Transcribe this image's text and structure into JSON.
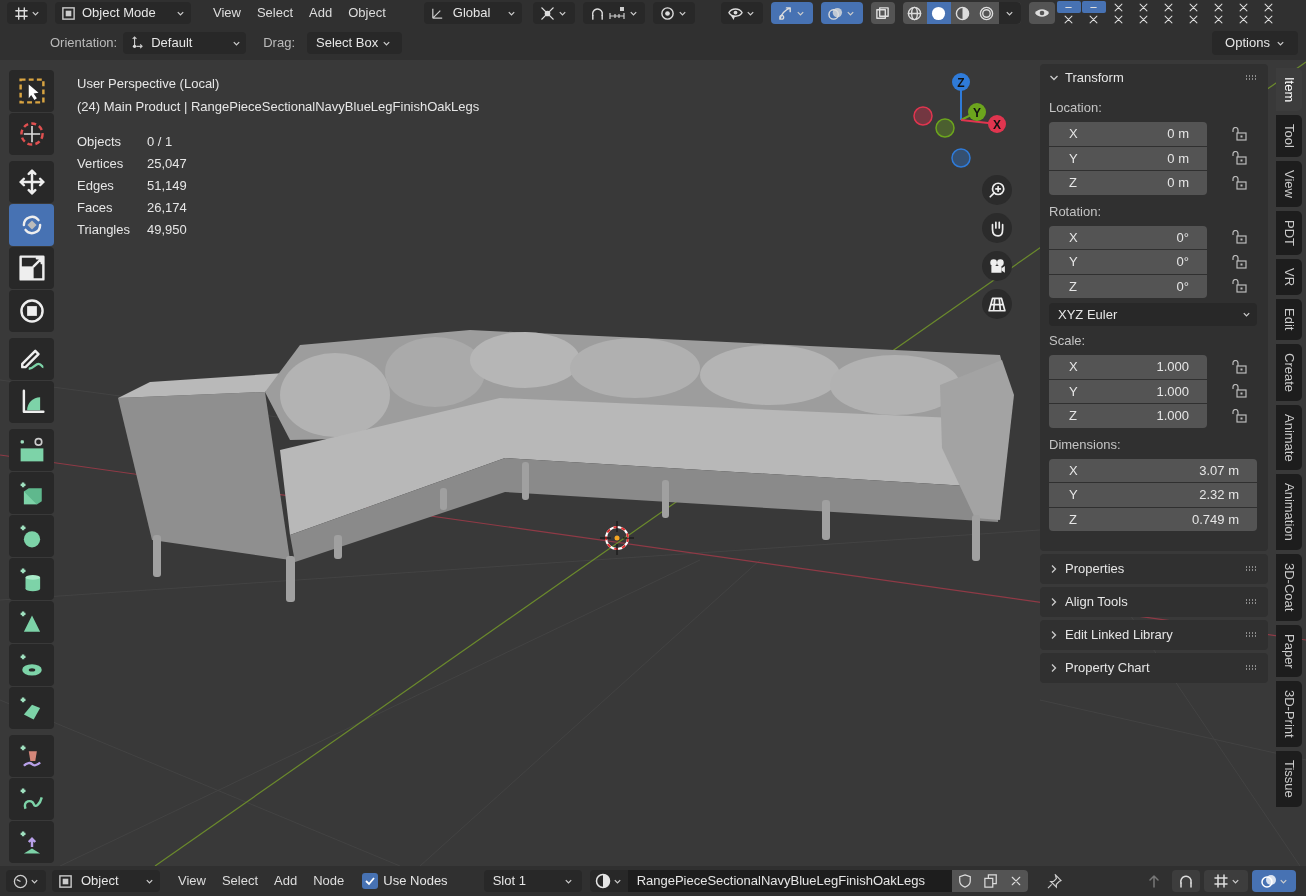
{
  "header": {
    "mode": "Object Mode",
    "menus": [
      "View",
      "Select",
      "Add",
      "Object"
    ],
    "orientation": "Global",
    "toggles": [
      {
        "kind": "pivot",
        "selected": false
      },
      {
        "kind": "snap",
        "selected": false
      },
      {
        "kind": "proportional",
        "selected": false
      },
      {
        "kind": "selectability",
        "selected": false
      },
      {
        "kind": "gizmo",
        "selected": true
      },
      {
        "kind": "overlay",
        "selected": true
      },
      {
        "kind": "xray",
        "selected": false
      }
    ],
    "shading": [
      {
        "kind": "wireframe",
        "selected": false
      },
      {
        "kind": "solid",
        "selected": true
      },
      {
        "kind": "material",
        "selected": false
      },
      {
        "kind": "rendered",
        "selected": false
      }
    ],
    "addon_icons": [
      {
        "kind": "minus",
        "selected": true
      },
      {
        "kind": "minus",
        "selected": true
      },
      {
        "kind": "cross",
        "selected": false
      },
      {
        "kind": "cross",
        "selected": false
      },
      {
        "kind": "cross",
        "selected": false
      },
      {
        "kind": "cross",
        "selected": false
      },
      {
        "kind": "cross",
        "selected": false
      },
      {
        "kind": "cross",
        "selected": false
      },
      {
        "kind": "cross",
        "selected": false
      },
      {
        "kind": "cross",
        "selected": false
      },
      {
        "kind": "cross",
        "selected": false
      },
      {
        "kind": "cross",
        "selected": false
      },
      {
        "kind": "cross",
        "selected": false
      },
      {
        "kind": "cross",
        "selected": false
      },
      {
        "kind": "cross",
        "selected": false
      },
      {
        "kind": "cross",
        "selected": false
      },
      {
        "kind": "cross",
        "selected": false
      },
      {
        "kind": "cross",
        "selected": false
      }
    ]
  },
  "tool_settings": {
    "orientation_label": "Orientation:",
    "orientation": "Default",
    "drag_label": "Drag:",
    "drag": "Select Box",
    "options": "Options"
  },
  "viewport": {
    "view_name": "User Perspective (Local)",
    "object_info": "(24) Main Product | RangePieceSectionalNavyBlueLegFinishOakLegs",
    "stats": [
      {
        "label": "Objects",
        "value": "0 / 1"
      },
      {
        "label": "Vertices",
        "value": "25,047"
      },
      {
        "label": "Edges",
        "value": "51,149"
      },
      {
        "label": "Faces",
        "value": "26,174"
      },
      {
        "label": "Triangles",
        "value": "49,950"
      }
    ],
    "gizmo_axes": [
      {
        "label": "Z",
        "color": "#2f7bd9"
      },
      {
        "label": "Y",
        "color": "#6ca51d"
      },
      {
        "label": "X",
        "color": "#e0354f"
      }
    ],
    "nav_buttons": [
      {
        "kind": "zoom"
      },
      {
        "kind": "pan"
      },
      {
        "kind": "camera"
      },
      {
        "kind": "ortho"
      }
    ]
  },
  "toolbar": [
    {
      "tools": [
        {
          "kind": "select_box",
          "selected": false
        },
        {
          "kind": "cursor",
          "selected": false
        }
      ]
    },
    {
      "tools": [
        {
          "kind": "move",
          "selected": false
        },
        {
          "kind": "rotate",
          "selected": true
        },
        {
          "kind": "scale",
          "selected": false
        },
        {
          "kind": "transform",
          "selected": false
        }
      ]
    },
    {
      "tools": [
        {
          "kind": "annotate",
          "selected": false
        },
        {
          "kind": "measure",
          "selected": false
        }
      ]
    },
    {
      "tools": [
        {
          "kind": "add_plane",
          "selected": false
        },
        {
          "kind": "add_cube",
          "selected": false
        },
        {
          "kind": "add_sphere",
          "selected": false
        },
        {
          "kind": "add_cylinder",
          "selected": false
        },
        {
          "kind": "add_cone",
          "selected": false
        },
        {
          "kind": "add_torus",
          "selected": false
        },
        {
          "kind": "add_wedge",
          "selected": false
        }
      ]
    },
    {
      "tools": [
        {
          "kind": "add_armature",
          "selected": false
        },
        {
          "kind": "add_curve",
          "selected": false
        },
        {
          "kind": "add_scatter",
          "selected": false
        }
      ]
    }
  ],
  "sidebar": {
    "transform": {
      "title": "Transform",
      "expanded": true,
      "sections": [
        {
          "kind": "vector",
          "label": "Location:",
          "fields": [
            {
              "axis": "X",
              "value": "0 m",
              "locked": false
            },
            {
              "axis": "Y",
              "value": "0 m",
              "locked": false
            },
            {
              "axis": "Z",
              "value": "0 m",
              "locked": false
            }
          ]
        },
        {
          "kind": "vector",
          "label": "Rotation:",
          "fields": [
            {
              "axis": "X",
              "value": "0°",
              "locked": false
            },
            {
              "axis": "Y",
              "value": "0°",
              "locked": false
            },
            {
              "axis": "Z",
              "value": "0°",
              "locked": false
            }
          ]
        },
        {
          "kind": "dropdown",
          "value": "XYZ Euler"
        },
        {
          "kind": "vector",
          "label": "Scale:",
          "fields": [
            {
              "axis": "X",
              "value": "1.000",
              "locked": false
            },
            {
              "axis": "Y",
              "value": "1.000",
              "locked": false
            },
            {
              "axis": "Z",
              "value": "1.000",
              "locked": false
            }
          ]
        },
        {
          "kind": "vector",
          "label": "Dimensions:",
          "fields": [
            {
              "axis": "X",
              "value": "3.07 m"
            },
            {
              "axis": "Y",
              "value": "2.32 m"
            },
            {
              "axis": "Z",
              "value": "0.749 m"
            }
          ]
        }
      ]
    },
    "panels": [
      {
        "title": "Properties",
        "expanded": false
      },
      {
        "title": "Align Tools",
        "expanded": false
      },
      {
        "title": "Edit Linked Library",
        "expanded": false
      },
      {
        "title": "Property Chart",
        "expanded": false
      }
    ],
    "tabs": [
      {
        "label": "Item",
        "selected": true
      },
      {
        "label": "Tool",
        "selected": false
      },
      {
        "label": "View",
        "selected": false
      },
      {
        "label": "PDT",
        "selected": false
      },
      {
        "label": "VR",
        "selected": false
      },
      {
        "label": "Edit",
        "selected": false
      },
      {
        "label": "Create",
        "selected": false
      },
      {
        "label": "Animate",
        "selected": false
      },
      {
        "label": "Animation",
        "selected": false
      },
      {
        "label": "3D-Coat",
        "selected": false
      },
      {
        "label": "Paper",
        "selected": false
      },
      {
        "label": "3D-Print",
        "selected": false
      },
      {
        "label": "Tissue",
        "selected": false
      }
    ]
  },
  "bottom_bar": {
    "mode": "Object",
    "menus": [
      "View",
      "Select",
      "Add",
      "Node"
    ],
    "use_nodes": {
      "label": "Use Nodes",
      "checked": true
    },
    "slot": "Slot 1",
    "material": "RangePieceSectionalNavyBlueLegFinishOakLegs",
    "right_icons": [
      {
        "kind": "up",
        "selected": false
      },
      {
        "kind": "snap",
        "selected": false
      },
      {
        "kind": "grid",
        "selected": false
      },
      {
        "kind": "overlay",
        "selected": true
      }
    ]
  }
}
